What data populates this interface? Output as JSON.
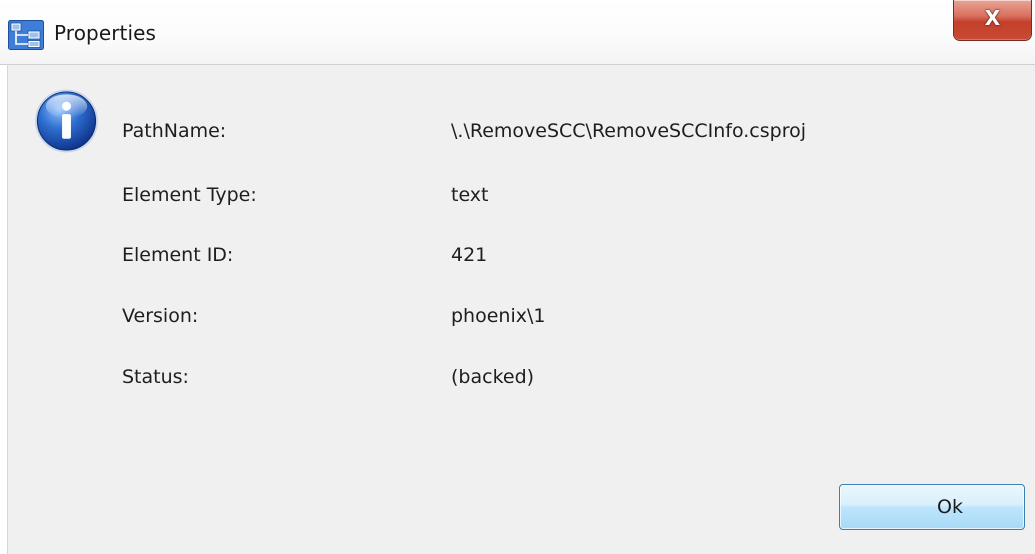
{
  "window": {
    "title": "Properties",
    "close_glyph": "X",
    "app_icon": "network-tree-icon",
    "info_icon": "info-icon"
  },
  "properties": [
    {
      "label": "PathName:",
      "value": "\\.\\RemoveSCC\\RemoveSCCInfo.csproj"
    },
    {
      "label": "Element Type:",
      "value": "text"
    },
    {
      "label": "Element ID:",
      "value": "421"
    },
    {
      "label": "Version:",
      "value": "phoenix\\1"
    },
    {
      "label": "Status:",
      "value": "(backed)"
    }
  ],
  "buttons": {
    "ok_label": "Ok"
  },
  "colors": {
    "client_background": "#f0f0f0",
    "close_button_red": "#c4402b",
    "ok_button_border": "#3c7fb1",
    "info_icon_blue": "#2a5fb8"
  }
}
